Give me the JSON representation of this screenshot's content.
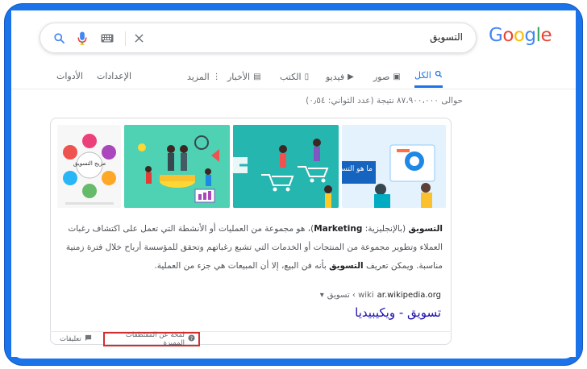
{
  "logo": {
    "letters": [
      "G",
      "o",
      "o",
      "g",
      "l",
      "e"
    ],
    "colors": [
      "#4285f4",
      "#ea4335",
      "#fbbc05",
      "#4285f4",
      "#34a853",
      "#ea4335"
    ]
  },
  "search": {
    "query": "التسويق",
    "icons": [
      "search-icon",
      "mic-icon",
      "keyboard-icon",
      "clear-icon"
    ]
  },
  "tabs": [
    {
      "label": "الكل",
      "icon": "🔍",
      "active": true
    },
    {
      "label": "صور",
      "icon": "▣",
      "active": false
    },
    {
      "label": "فيديو",
      "icon": "▶",
      "active": false
    },
    {
      "label": "الكتب",
      "icon": "▯",
      "active": false
    },
    {
      "label": "الأخبار",
      "icon": "▤",
      "active": false
    },
    {
      "label": "المزيد",
      "icon": "⋮",
      "active": false
    }
  ],
  "tools": {
    "settings": "الإعدادات",
    "tools": "الأدوات"
  },
  "result_stats": "حوالى ٨٧،٩٠٠،٠٠٠ نتيجة (عدد الثواني: ٠٫٥٤)",
  "featured_snippet": {
    "images": [
      {
        "alt": "ما هو التسويق",
        "bg": "#dceffd",
        "caption": "ما هو التسويق"
      },
      {
        "alt": "shopping carts",
        "bg": "#2bb5b1"
      },
      {
        "alt": "marketing team",
        "bg": "#3fc4a8"
      },
      {
        "alt": "مزيج التسويق",
        "bg": "#f8f8f8",
        "caption": "مزيج التسويق"
      }
    ],
    "text_lines": [
      {
        "bold": "التسويق",
        "rest": " (بالإنجليزية: "
      },
      {
        "bold": "Marketing",
        "rest": ")، هو مجموعة من العمليات أو الأنشطة التي تعمل على اكتشاف رغبات"
      },
      {
        "bold": "",
        "rest": "العملاء وتطوير مجموعة من المنتجات أو الخدمات التي تشبع رغباتهم وتحقق للمؤسسة أرباح خلال فترة زمنية"
      },
      {
        "bold": "",
        "rest": "مناسبة. ويمكن تعريف "
      },
      {
        "bold": "التسويق",
        "rest": " بأنه فن البيع، إلا أن المبيعات هي جزء من العملية."
      }
    ],
    "source": {
      "domain": "ar.wikipedia.org",
      "path": "wiki › تسويق",
      "arrow": "▾"
    },
    "title": "تسويق - ويكيبيديا"
  },
  "footer": {
    "about": "لمحة عن المقتطفات المميزة",
    "feedback": "تعليقات"
  }
}
